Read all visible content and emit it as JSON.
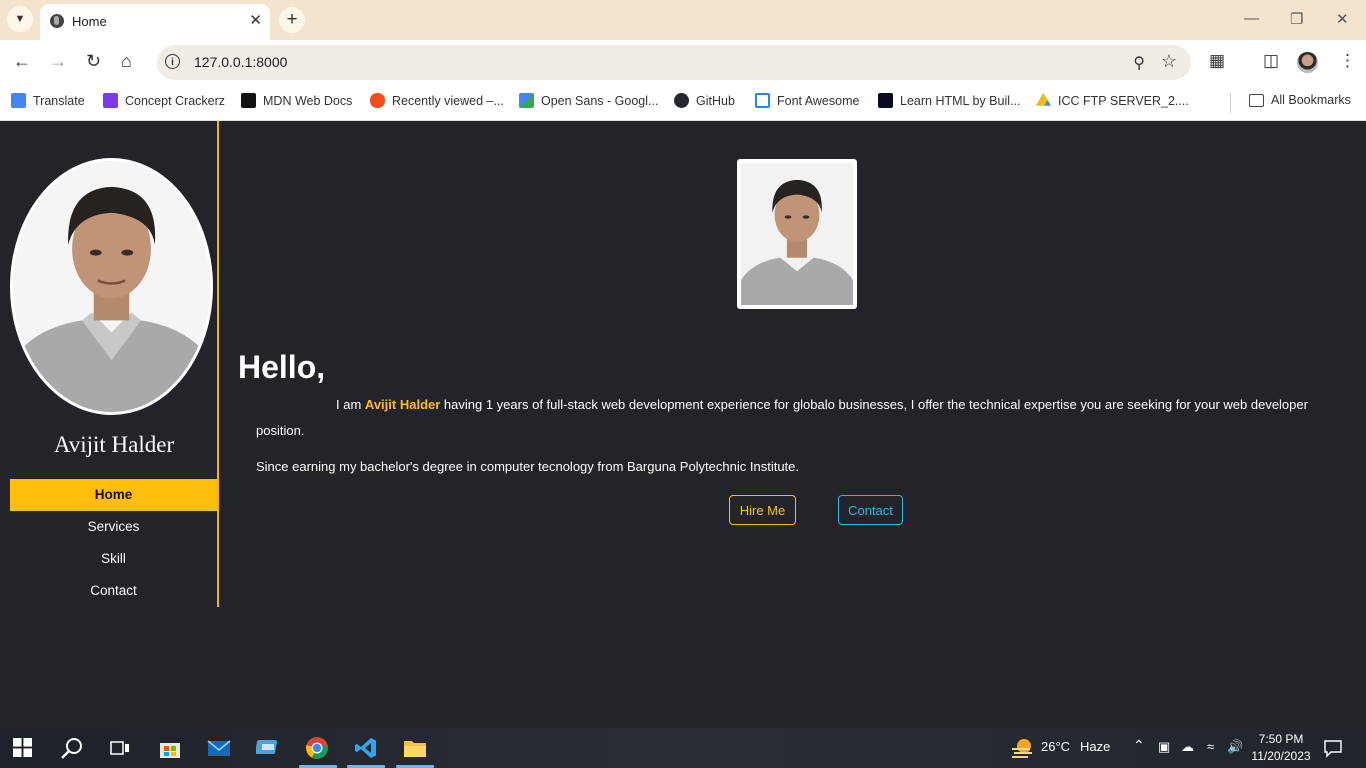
{
  "browser": {
    "tab_title": "Home",
    "url": "127.0.0.1:8000",
    "bookmarks": [
      {
        "label": "Translate",
        "icon": "translate-icon",
        "color": "#4285f4"
      },
      {
        "label": "Concept Crackerz",
        "icon": "concept-crackerz-icon",
        "color": "#7c3aed"
      },
      {
        "label": "MDN Web Docs",
        "icon": "mdn-icon",
        "color": "#111111"
      },
      {
        "label": "Recently viewed –...",
        "icon": "figma-icon",
        "color": "#f24e1e"
      },
      {
        "label": "Open Sans - Googl...",
        "icon": "google-fonts-icon",
        "color": "#34a853"
      },
      {
        "label": "GitHub",
        "icon": "github-icon",
        "color": "#24292f"
      },
      {
        "label": "Font Awesome",
        "icon": "font-awesome-icon",
        "color": "#228ae6"
      },
      {
        "label": "Learn HTML by Buil...",
        "icon": "freecodecamp-icon",
        "color": "#0a0a23"
      },
      {
        "label": "ICC FTP SERVER_2....",
        "icon": "google-drive-icon",
        "color": "#fbbc04"
      }
    ],
    "all_bookmarks_label": "All Bookmarks"
  },
  "sidebar": {
    "name": "Avijit Halder",
    "nav": [
      {
        "label": "Home",
        "active": true
      },
      {
        "label": "Services",
        "active": false
      },
      {
        "label": "Skill",
        "active": false
      },
      {
        "label": "Contact",
        "active": false
      }
    ]
  },
  "main": {
    "greeting": "Hello,",
    "intro_prefix": "I am",
    "intro_name": "Avijit Halder",
    "intro_rest": "having 1 years of full-stack web development experience for globalo businesses, I offer the technical expertise you are seeking for your web developer position.",
    "degree": "Since earning my bachelor's degree in computer tecnology from Barguna Polytechnic Institute.",
    "hire_label": "Hire Me",
    "contact_label": "Contact"
  },
  "taskbar": {
    "temperature": "26°C",
    "weather": "Haze",
    "time": "7:50 PM",
    "date": "11/20/2023"
  },
  "colors": {
    "accent": "#ffbe0b",
    "contact": "#2fb4e8",
    "page_bg": "#22242a"
  }
}
